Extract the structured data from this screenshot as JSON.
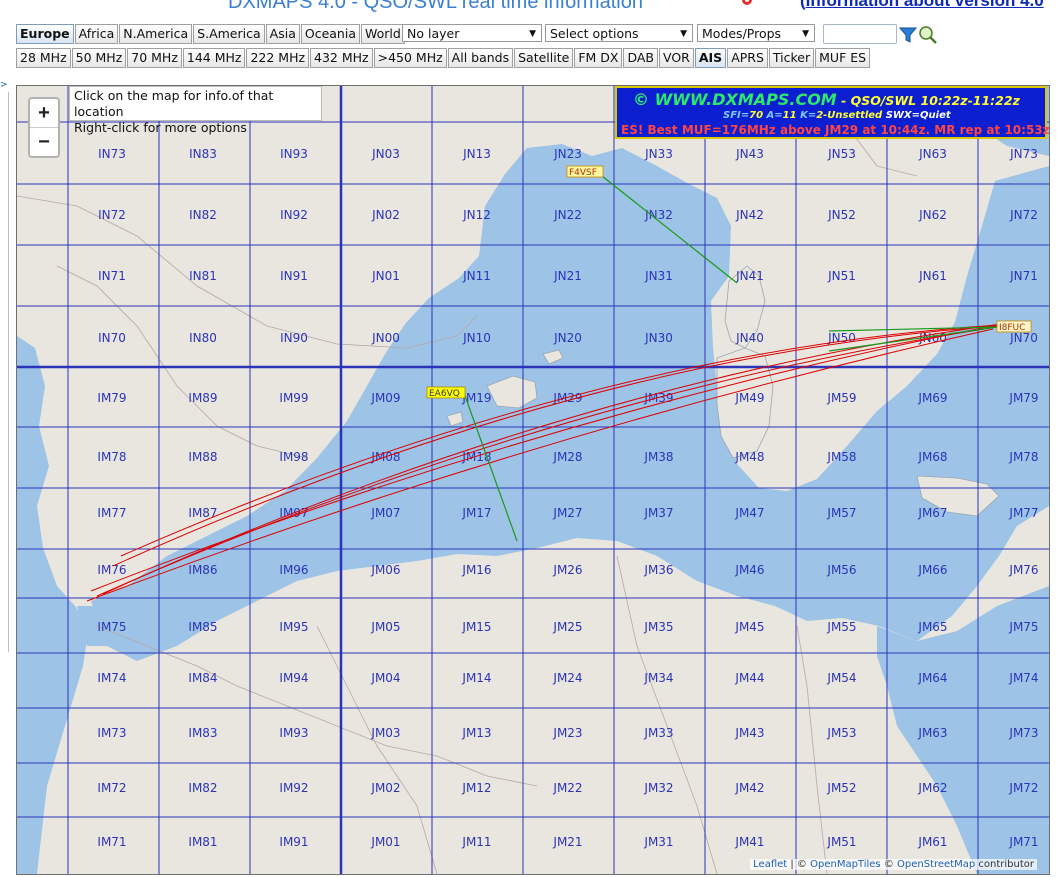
{
  "header": {
    "title": "DXMAPS 4.0 - QSO/SWL real time information",
    "info_prefix": "(",
    "info_link": "Information about version 4.0"
  },
  "regions": [
    "Europe",
    "Africa",
    "N.America",
    "S.America",
    "Asia",
    "Oceania",
    "World"
  ],
  "active_region": "Europe",
  "selects": {
    "layer": "No layer",
    "options": "Select options",
    "modes": "Modes/Props"
  },
  "bands": [
    "28 MHz",
    "50 MHz",
    "70 MHz",
    "144 MHz",
    "222 MHz",
    "432 MHz",
    ">450 MHz",
    "All bands",
    "Satellite",
    "FM DX",
    "DAB",
    "VOR",
    "AIS",
    "APRS",
    "Ticker",
    "MUF ES"
  ],
  "active_band": "AIS",
  "map": {
    "zoom_in": "+",
    "zoom_out": "−",
    "hint_line1": "Click on the map for info.of that location",
    "hint_line2": "Right-click for more options",
    "locators": {
      "cols": [
        "IN7/IM7",
        "IN8/IM8",
        "IN9/IM9",
        "JN0/JM0",
        "JN1/JM1",
        "JN2/JM2",
        "JN3/JM3",
        "JN4/JM4",
        "JN5/JM5",
        "JN6/JM6",
        "JN7/JM7"
      ],
      "rows": [
        [
          "IN73",
          "IN83",
          "IN93",
          "JN03",
          "JN13",
          "JN23",
          "JN33",
          "JN43",
          "JN53",
          "JN63",
          "JN73"
        ],
        [
          "IN72",
          "IN82",
          "IN92",
          "JN02",
          "JN12",
          "JN22",
          "JN32",
          "JN42",
          "JN52",
          "JN62",
          "JN72"
        ],
        [
          "IN71",
          "IN81",
          "IN91",
          "JN01",
          "JN11",
          "JN21",
          "JN31",
          "JN41",
          "JN51",
          "JN61",
          "JN71"
        ],
        [
          "IN70",
          "IN80",
          "IN90",
          "JN00",
          "JN10",
          "JN20",
          "JN30",
          "JN40",
          "JN50",
          "JN60",
          "JN70"
        ],
        [
          "IM79",
          "IM89",
          "IM99",
          "JM09",
          "JM19",
          "JM29",
          "JM39",
          "JM49",
          "JM59",
          "JM69",
          "JM79"
        ],
        [
          "IM78",
          "IM88",
          "IM98",
          "JM08",
          "JM18",
          "JM28",
          "JM38",
          "JM48",
          "JM58",
          "JM68",
          "JM78"
        ],
        [
          "IM77",
          "IM87",
          "IM97",
          "JM07",
          "JM17",
          "JM27",
          "JM37",
          "JM47",
          "JM57",
          "JM67",
          "JM77"
        ],
        [
          "IM76",
          "IM86",
          "IM96",
          "JM06",
          "JM16",
          "JM26",
          "JM36",
          "JM46",
          "JM56",
          "JM66",
          "JM76"
        ],
        [
          "IM75",
          "IM85",
          "IM95",
          "JM05",
          "JM15",
          "JM25",
          "JM35",
          "JM45",
          "JM55",
          "JM65",
          "JM75"
        ],
        [
          "IM74",
          "IM84",
          "IM94",
          "JM04",
          "JM14",
          "JM24",
          "JM34",
          "JM44",
          "JM54",
          "JM64",
          "JM74"
        ],
        [
          "IM73",
          "IM83",
          "IM93",
          "JM03",
          "JM13",
          "JM23",
          "JM33",
          "JM43",
          "JM53",
          "JM63",
          "JM73"
        ],
        [
          "IM72",
          "IM82",
          "IM92",
          "JM02",
          "JM12",
          "JM22",
          "JM32",
          "JM42",
          "JM52",
          "JM62",
          "JM72"
        ],
        [
          "IM71",
          "IM81",
          "IM91",
          "JM01",
          "JM11",
          "JM21",
          "JM31",
          "JM41",
          "JM51",
          "JM61",
          "JM71"
        ]
      ]
    },
    "stations": [
      "F4VSF",
      "EA6VQ",
      "I8FUC"
    ],
    "banner": {
      "site": "© WWW.DXMAPS.COM",
      "span": " - QSO/SWL 10:22z-11:22z",
      "sfi_k": "SFI=",
      "sfi_v": "70",
      "a_k": " A=",
      "a_v": "11",
      "k_k": " K=",
      "k_v": "2-Unsettled",
      "swx_k": " SWX=",
      "swx_v": "Quiet",
      "alert": "ES! Best MUF=176MHz above JM29 at 10:44z. MR rep at 10:53z"
    },
    "attribution": {
      "leaflet": "Leaflet",
      "sep1": " | © ",
      "omt": "OpenMapTiles",
      "sep2": " © ",
      "osm": "OpenStreetMap",
      "rest": " contributor"
    }
  },
  "colors": {
    "sea": "#9dc3e6",
    "land": "#e9e6df",
    "grid": "#2b34b8",
    "path_red": "#dd0000",
    "path_green": "#1a9a1a",
    "banner_bg": "#0b1fd0",
    "title": "#3a7fd0"
  }
}
